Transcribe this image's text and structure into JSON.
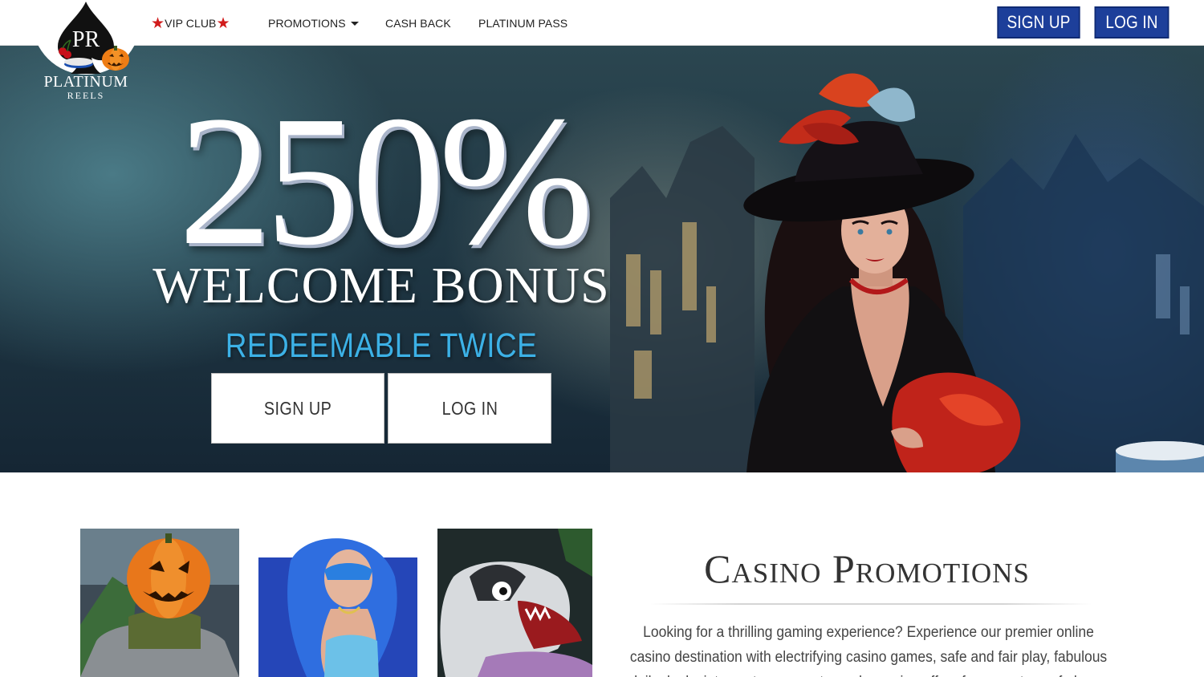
{
  "brand": {
    "monogram": "PR",
    "name_line1": "PLATINUM",
    "name_line2": "REELS"
  },
  "nav": {
    "vip_club": "VIP CLUB",
    "promotions": "PROMOTIONS",
    "cash_back": "CASH BACK",
    "platinum_pass": "PLATINUM PASS",
    "sign_up": "SIGN UP",
    "log_in": "LOG IN"
  },
  "hero": {
    "percent": "250%",
    "headline": "WELCOME BONUS",
    "subheadline": "REDEEMABLE TWICE",
    "sign_up": "SIGN UP",
    "log_in": "LOG IN"
  },
  "promo": {
    "title": "Casino Promotions",
    "body": "Looking for a thrilling gaming experience? Experience our premier online casino destination with electrifying casino games, safe and fair play, fabulous daily deals, intense tournaments, and amazing offers for every type of player."
  },
  "colors": {
    "nav_button": "#1d3f9a",
    "accent_blue": "#3cb1e6",
    "star_red": "#d11c1c"
  },
  "icons": [
    "star-icon",
    "caret-down-icon",
    "spade-logo-icon",
    "pumpkin-icon"
  ]
}
